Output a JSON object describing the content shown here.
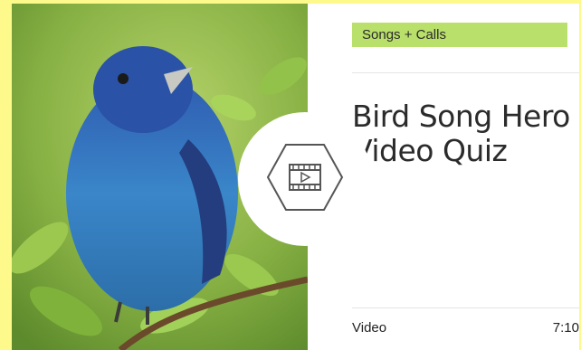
{
  "card": {
    "category": "Songs + Calls",
    "title": "Bird Song Hero Video Quiz",
    "media_type": "Video",
    "duration": "7:10"
  },
  "icons": {
    "media": "video-play-icon"
  },
  "colors": {
    "page_background": "#fdf98a",
    "badge_background": "#b9e06a",
    "text": "#2b2b2b"
  }
}
